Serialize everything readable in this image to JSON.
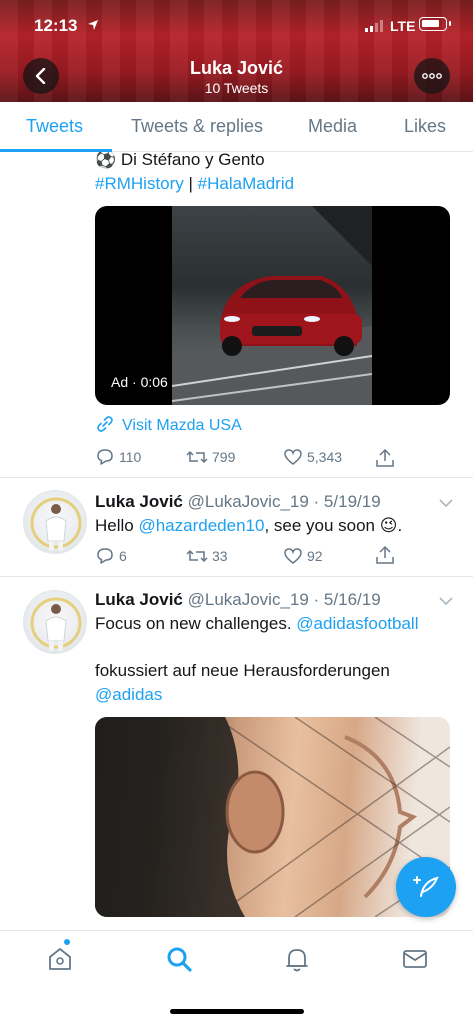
{
  "status_bar": {
    "time": "12:13",
    "network": "LTE"
  },
  "header": {
    "title": "Luka Jović",
    "subtitle": "10 Tweets"
  },
  "tabs": [
    "Tweets",
    "Tweets & replies",
    "Media",
    "Likes"
  ],
  "ad_tweet": {
    "text_line1": "⚽ Di Stéfano y Gento",
    "hashtag1": "#RMHistory",
    "separator": " | ",
    "hashtag2": "#HalaMadrid",
    "video_label": "Ad · 0:06",
    "visit_link": "Visit Mazda USA",
    "replies": "110",
    "retweets": "799",
    "likes": "5,343"
  },
  "tweet1": {
    "name": "Luka Jović",
    "handle_date": "@LukaJovic_19 · 5/19/19",
    "text_prefix": "Hello ",
    "mention": "@hazardeden10",
    "text_suffix": ", see you soon 😉.",
    "replies": "6",
    "retweets": "33",
    "likes": "92"
  },
  "tweet2": {
    "name": "Luka Jović",
    "handle_date": "@LukaJovic_19 · 5/16/19",
    "text_line1": "Focus on new challenges. ",
    "mention1": "@adidasfootball",
    "text_line2": "fokussiert auf neue Herausforderungen",
    "mention2": "@adidas"
  },
  "colors": {
    "accent": "#1da1f2",
    "muted": "#657786",
    "text": "#14171a"
  },
  "icons": [
    "back-arrow-icon",
    "more-icon",
    "link-icon",
    "reply-icon",
    "retweet-icon",
    "like-icon",
    "share-icon",
    "home-icon",
    "search-icon",
    "notifications-icon",
    "messages-icon",
    "compose-icon"
  ]
}
